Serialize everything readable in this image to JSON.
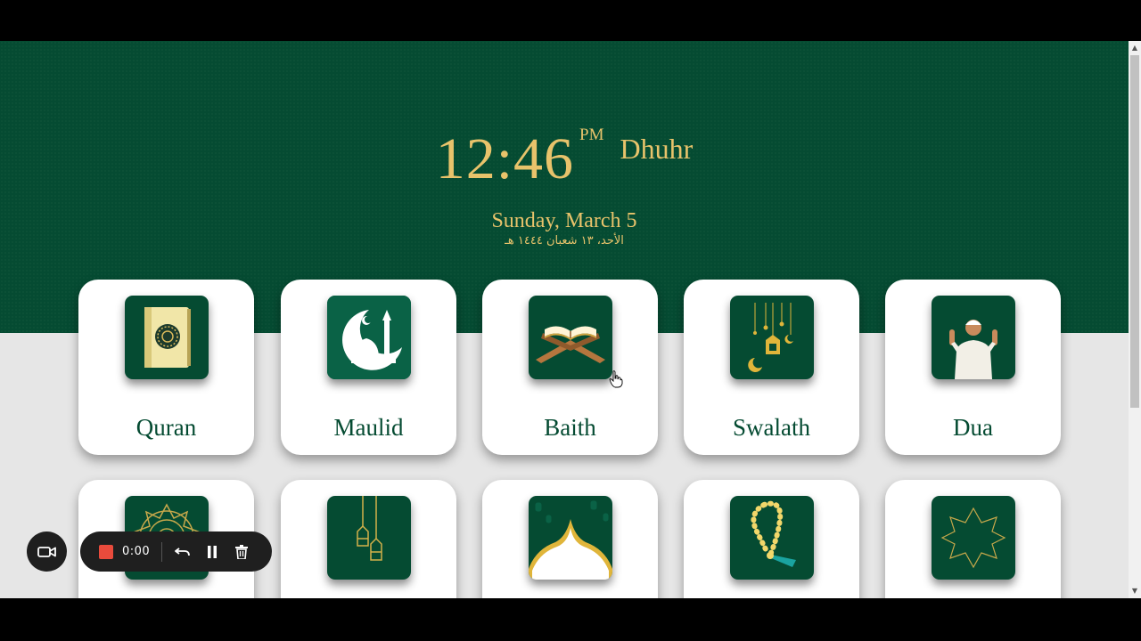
{
  "clock": {
    "time": "12:46",
    "ampm": "PM",
    "prayer": "Dhuhr"
  },
  "date": {
    "gregorian": "Sunday, March 5",
    "hijri": "الأحد، ١٣ شعبان ١٤٤٤ هـ"
  },
  "cards": [
    {
      "label": "Quran",
      "icon": "quran-book-icon"
    },
    {
      "label": "Maulid",
      "icon": "mosque-crescent-icon"
    },
    {
      "label": "Baith",
      "icon": "quran-stand-icon"
    },
    {
      "label": "Swalath",
      "icon": "hanging-lanterns-icon"
    },
    {
      "label": "Dua",
      "icon": "praying-man-icon"
    },
    {
      "label": "",
      "icon": "mandala-icon"
    },
    {
      "label": "",
      "icon": "lanterns-icon"
    },
    {
      "label": "",
      "icon": "mosque-dome-icon"
    },
    {
      "label": "",
      "icon": "tasbih-icon"
    },
    {
      "label": "",
      "icon": "star-octagram-icon"
    }
  ],
  "recorder": {
    "time": "0:00"
  },
  "colors": {
    "green": "#054b32",
    "gold": "#e8c36b",
    "record": "#e94b3c"
  }
}
